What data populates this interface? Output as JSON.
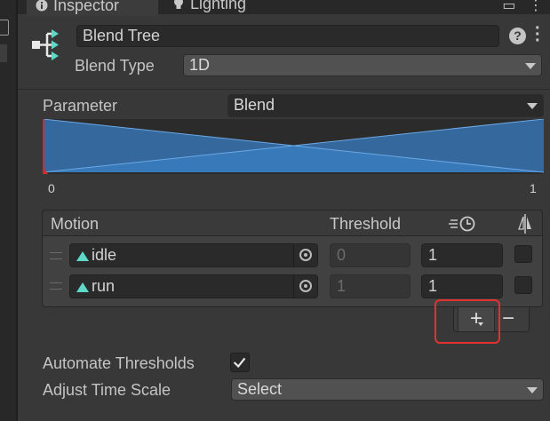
{
  "tabs": [
    {
      "label": "Inspector",
      "icon": "info-icon"
    },
    {
      "label": "Lighting",
      "icon": "lightbulb-icon"
    }
  ],
  "header": {
    "name": "Blend Tree",
    "blend_type_label": "Blend Type",
    "blend_type_value": "1D"
  },
  "parameter": {
    "label": "Parameter",
    "value": "Blend"
  },
  "graph": {
    "min_label": "0",
    "max_label": "1",
    "colors": {
      "fill": "#3a7fc4",
      "line": "#6aa8e6",
      "marker": "#d22a2a"
    }
  },
  "motion_list": {
    "col_motion": "Motion",
    "col_threshold": "Threshold",
    "col_speed_icon": "time-scale-icon",
    "col_mirror_icon": "mirror-icon",
    "rows": [
      {
        "motion": "idle",
        "threshold": "0",
        "speed": "1"
      },
      {
        "motion": "run",
        "threshold": "1",
        "speed": "1"
      }
    ]
  },
  "list_buttons": {
    "add": "+",
    "remove": "−"
  },
  "automate_thresholds": {
    "label": "Automate Thresholds",
    "checked": true
  },
  "adjust_time_scale": {
    "label": "Adjust Time Scale",
    "value": "Select"
  },
  "accent_colors": {
    "tab_highlight": "#3a79bb",
    "callout": "#e53030",
    "anim_icon": "#5fd8c8"
  }
}
